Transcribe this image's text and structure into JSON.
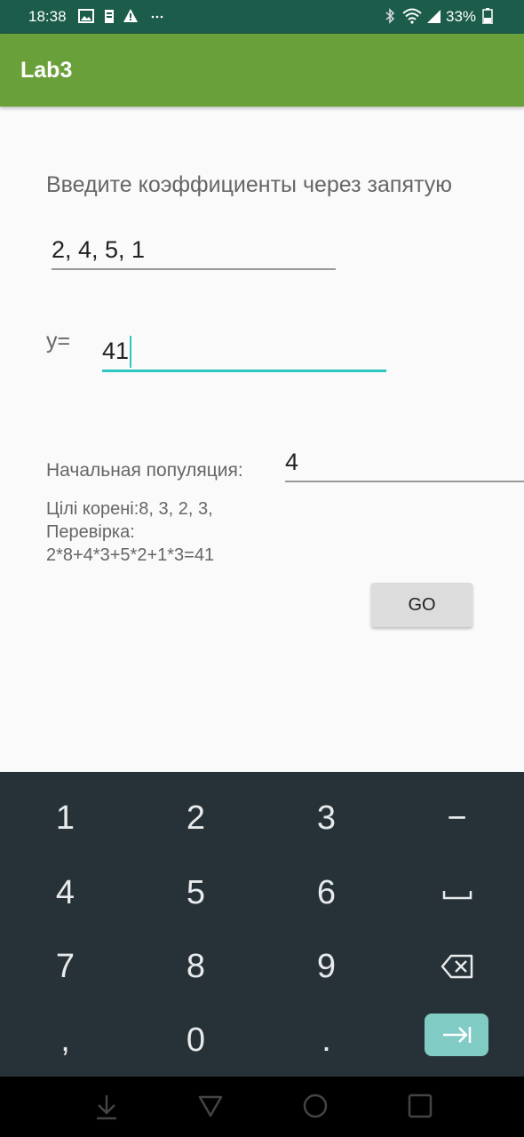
{
  "status_bar": {
    "time": "18:38",
    "battery": "33%",
    "left_icons": [
      "image-icon",
      "storage-icon",
      "warning-icon",
      "more-icon"
    ],
    "right_icons": [
      "bluetooth-icon",
      "wifi-icon",
      "signal-icon",
      "battery-icon"
    ]
  },
  "app_bar": {
    "title": "Lab3"
  },
  "form": {
    "prompt": "Введите коэффициенты через запятую",
    "coefficients_value": "2, 4, 5, 1",
    "y_label": "y=",
    "y_value": "41",
    "population_label": "Начальная популяция:",
    "population_value": "4",
    "result_line1": "Цілі корені:8, 3, 2, 3,",
    "result_line2": "Перевірка:",
    "result_line3": "2*8+4*3+5*2+1*3=41",
    "go_label": "GO"
  },
  "keyboard": {
    "row1": [
      "1",
      "2",
      "3",
      "−"
    ],
    "row2": [
      "4",
      "5",
      "6"
    ],
    "row3": [
      "7",
      "8",
      "9"
    ],
    "row4": [
      ",",
      "0",
      "."
    ],
    "special_keys": [
      "space-key",
      "backspace-key",
      "next-tab-key"
    ]
  },
  "nav_bar": {
    "icons": [
      "hide-keyboard-icon",
      "back-icon",
      "home-icon",
      "recents-icon"
    ]
  },
  "colors": {
    "status_bar": "#1c5c4a",
    "app_bar": "#6aa03a",
    "accent": "#2fc6c0",
    "keyboard_bg": "#263238",
    "tab_key": "#80cbc4"
  }
}
